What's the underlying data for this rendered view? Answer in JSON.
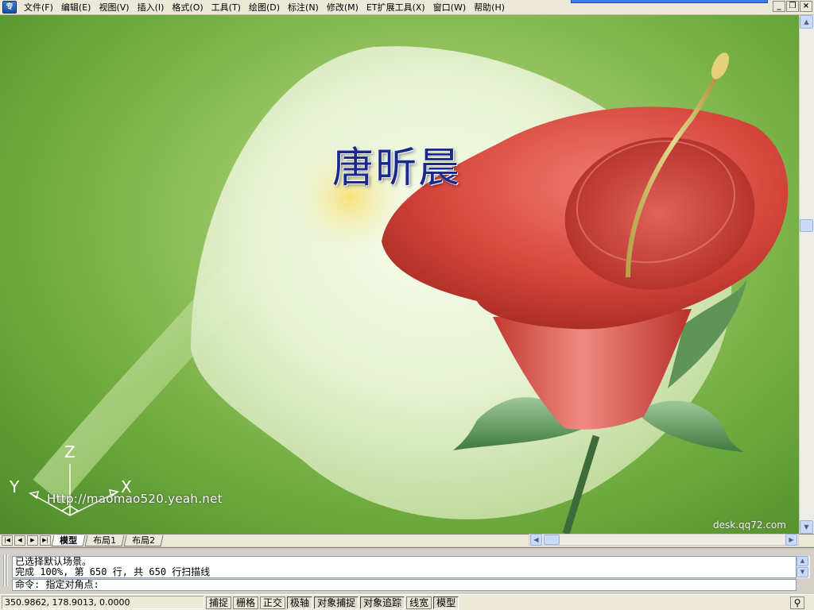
{
  "menu": {
    "app_icon": "专",
    "items": [
      "文件(F)",
      "编辑(E)",
      "视图(V)",
      "插入(I)",
      "格式(O)",
      "工具(T)",
      "绘图(D)",
      "标注(N)",
      "修改(M)",
      "ET扩展工具(X)",
      "窗口(W)",
      "帮助(H)"
    ]
  },
  "window_buttons": {
    "minimize": "_",
    "restore": "❐",
    "close": "×"
  },
  "canvas": {
    "caption": "唐昕晨",
    "watermark": "Http://maomao520.yeah.net",
    "credit": "desk.qq72.com",
    "ucs": {
      "z": "Z",
      "y": "Y",
      "x": "X"
    }
  },
  "tabs": {
    "nav": [
      "|◀",
      "◀",
      "▶",
      "▶|"
    ],
    "items": [
      "模型",
      "布局1",
      "布局2"
    ],
    "active": "模型"
  },
  "command": {
    "history": [
      "已选择默认场景。",
      "完成 100%, 第 650 行, 共 650 行扫描线"
    ],
    "prompt": "命令: 指定对角点:"
  },
  "status": {
    "coords": "350.9862, 178.9013, 0.0000",
    "toggles": [
      "捕捉",
      "栅格",
      "正交",
      "极轴",
      "对象捕捉",
      "对象追踪",
      "线宽",
      "模型"
    ],
    "active_toggles": [
      "极轴",
      "对象捕捉",
      "对象追踪",
      "模型"
    ]
  },
  "icons": {
    "app": "app-logo-icon",
    "tray": "network-tray-icon"
  },
  "colors": {
    "menu_bg": "#ece9d8",
    "canvas_green": "#6fab3e",
    "flower_red": "#d9403a",
    "caption_blue": "#1a2a8a"
  }
}
